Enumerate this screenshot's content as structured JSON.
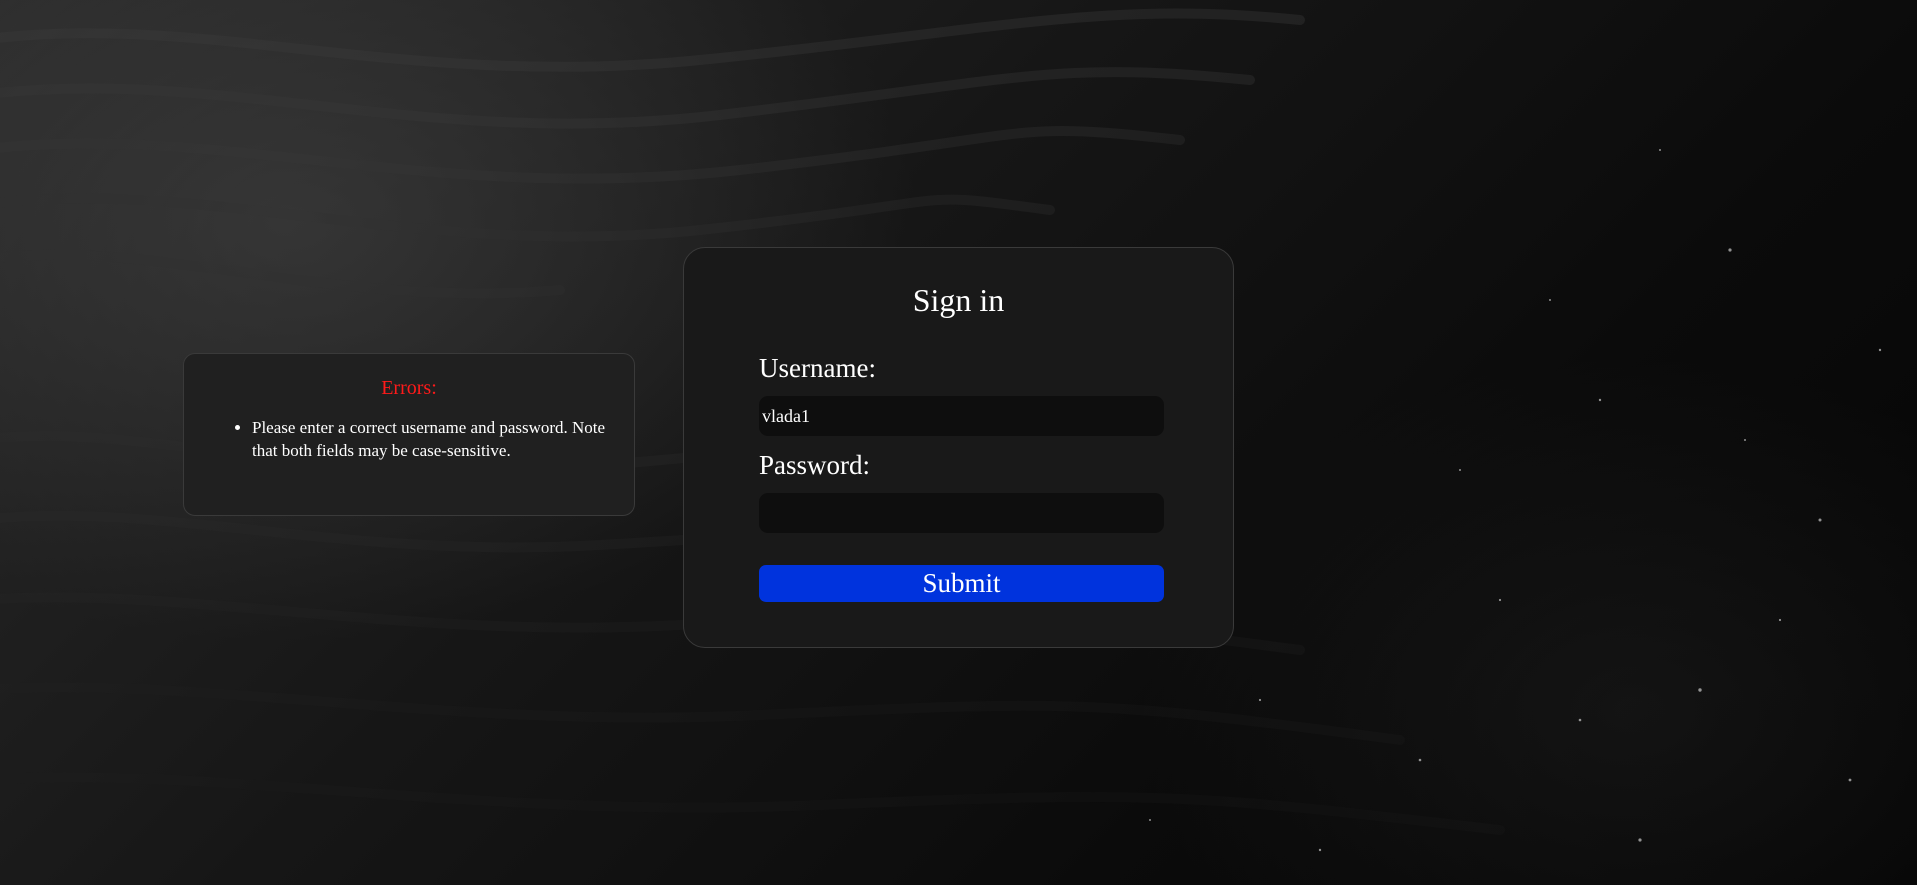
{
  "errors": {
    "title": "Errors:",
    "messages": [
      "Please enter a correct username and password. Note that both fields may be case-sensitive."
    ]
  },
  "signin": {
    "title": "Sign in",
    "username_label": "Username:",
    "username_value": "vlada1",
    "password_label": "Password:",
    "password_value": "",
    "submit_label": "Submit"
  },
  "colors": {
    "error_title": "#ff1a1a",
    "submit_background": "#0033dd",
    "card_background": "#191919",
    "input_background": "#0e0e0e"
  }
}
